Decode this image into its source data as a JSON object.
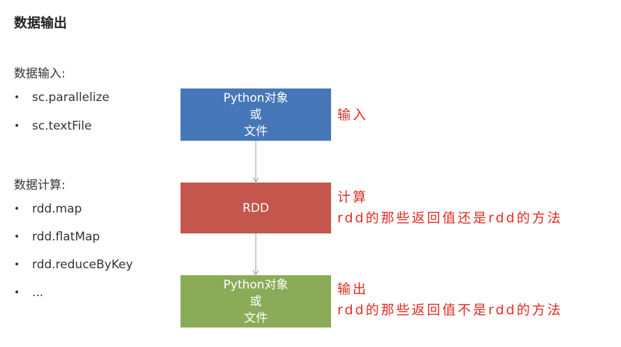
{
  "title": "数据输出",
  "input_section": {
    "heading": "数据输入:",
    "items": [
      "sc.parallelize",
      "sc.textFile"
    ]
  },
  "compute_section": {
    "heading": "数据计算:",
    "items": [
      "rdd.map",
      "rdd.flatMap",
      "rdd.reduceByKey",
      "..."
    ]
  },
  "bullet_glyph": "•",
  "flow": {
    "input_box": {
      "line1": "Python对象",
      "line2": "或",
      "line3": "文件"
    },
    "compute_box": {
      "label": "RDD"
    },
    "output_box": {
      "line1": "Python对象",
      "line2": "或",
      "line3": "文件"
    }
  },
  "annotations": {
    "input": "输入",
    "compute_title": "计算",
    "compute_desc": "rdd的那些返回值还是rdd的方法",
    "output_title": "输出",
    "output_desc": "rdd的那些返回值不是rdd的方法"
  },
  "colors": {
    "input_box": "#4677b8",
    "compute_box": "#c4564e",
    "output_box": "#8aac58",
    "annotation": "#e02a20",
    "arrow": "#7a9ccc"
  }
}
